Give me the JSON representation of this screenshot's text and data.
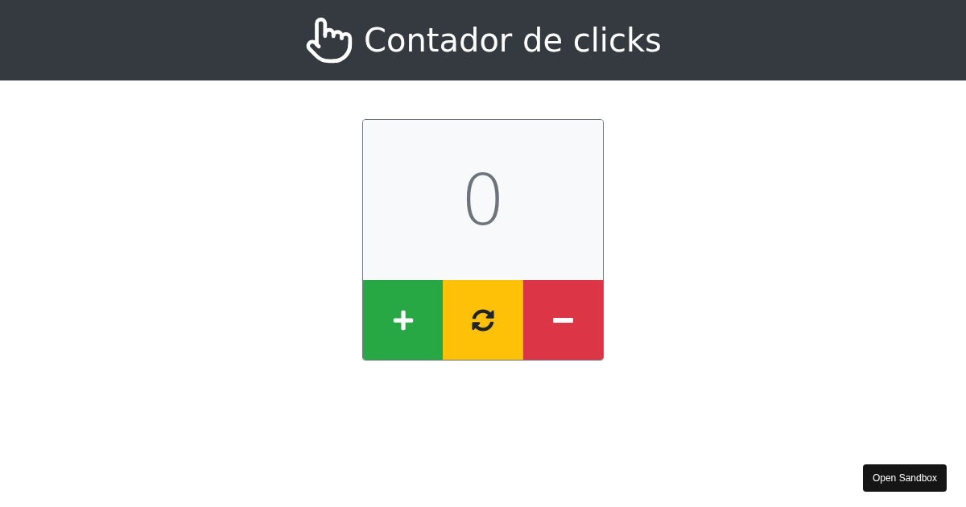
{
  "header": {
    "title": "Contador de clicks"
  },
  "counter": {
    "value": "0"
  },
  "controls": [
    {
      "kind": "increment"
    },
    {
      "kind": "reset"
    },
    {
      "kind": "decrement"
    }
  ],
  "sandbox_button": {
    "label": "Open Sandbox"
  }
}
